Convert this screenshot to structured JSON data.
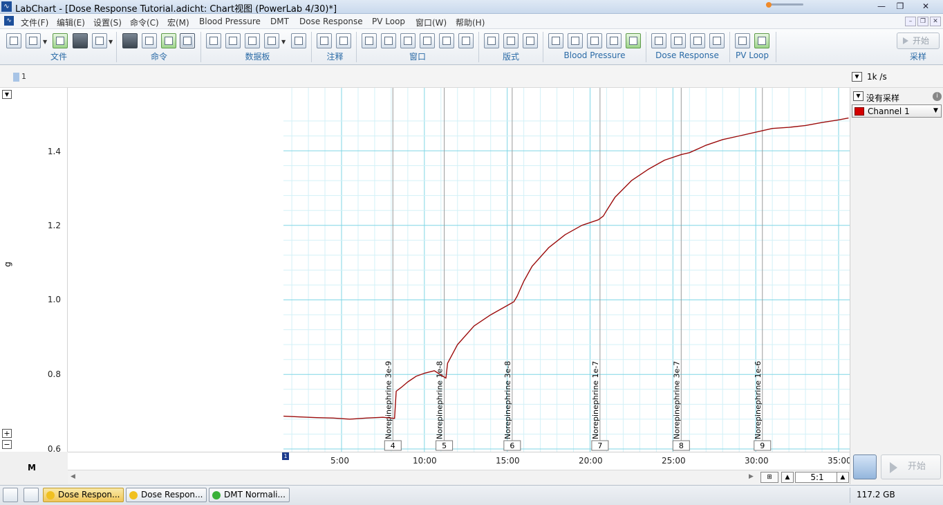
{
  "window": {
    "title": "LabChart - [Dose Response Tutorial.adicht: Chart视图 (PowerLab 4/30)*]",
    "app_icon": "labchart-icon",
    "controls": [
      "—",
      "❐",
      "✕"
    ]
  },
  "menu": {
    "items": [
      "文件(F)",
      "编辑(E)",
      "设置(S)",
      "命令(C)",
      "宏(M)",
      "Blood Pressure",
      "DMT",
      "Dose Response",
      "PV Loop",
      "窗口(W)",
      "帮助(H)"
    ],
    "mdi_controls": [
      "–",
      "❐",
      "✕"
    ]
  },
  "toolbar": {
    "groups": [
      "文件",
      "命令",
      "数据板",
      "注释",
      "窗口",
      "版式",
      "Blood Pressure",
      "Dose Response",
      "PV Loop",
      "采样"
    ],
    "start_label": "开始"
  },
  "channel_strip": {
    "channel_number": "1",
    "rate": "1k /s"
  },
  "left_axis": {
    "unit": "g",
    "ticks": [
      "1.4",
      "1.2",
      "1.0",
      "0.8",
      "0.6"
    ],
    "bottom_marker": "M"
  },
  "x_axis": {
    "ticks": [
      "5:00",
      "10:00",
      "15:00",
      "20:00",
      "25:00",
      "30:00",
      "35:00"
    ],
    "block_marker": "1"
  },
  "right_panel": {
    "sampling_status": "没有采样",
    "channel_select": "Channel 1",
    "channel_color": "#d40000"
  },
  "scroll": {
    "ratio": "5:1"
  },
  "bottom_start_label": "开始",
  "statusbar": {
    "tabs": [
      "Dose Respon...",
      "Dose Respon...",
      "DMT Normali..."
    ],
    "tab_dot_colors": [
      "#f0c020",
      "#f0c020",
      "#38b038"
    ],
    "disk": "117.2 GB"
  },
  "chart_data": {
    "type": "line",
    "xlabel": "",
    "ylabel": "g",
    "xlim_minutes": [
      1.5,
      35.6
    ],
    "ylim": [
      0.6,
      1.5
    ],
    "series": [
      {
        "color": "#9b0b0b",
        "points": [
          [
            1.5,
            0.688
          ],
          [
            2.5,
            0.686
          ],
          [
            3.5,
            0.684
          ],
          [
            4.5,
            0.683
          ],
          [
            5.5,
            0.68
          ],
          [
            6.5,
            0.683
          ],
          [
            7.5,
            0.685
          ],
          [
            8.2,
            0.682
          ],
          [
            8.3,
            0.755
          ],
          [
            8.6,
            0.765
          ],
          [
            9.0,
            0.78
          ],
          [
            9.5,
            0.795
          ],
          [
            10.0,
            0.803
          ],
          [
            10.6,
            0.81
          ],
          [
            11.3,
            0.79
          ],
          [
            11.4,
            0.83
          ],
          [
            12.0,
            0.88
          ],
          [
            13.0,
            0.93
          ],
          [
            14.0,
            0.96
          ],
          [
            15.0,
            0.985
          ],
          [
            15.4,
            0.995
          ],
          [
            15.6,
            1.01
          ],
          [
            16.0,
            1.05
          ],
          [
            16.5,
            1.09
          ],
          [
            17.5,
            1.14
          ],
          [
            18.5,
            1.175
          ],
          [
            19.5,
            1.2
          ],
          [
            20.5,
            1.215
          ],
          [
            20.8,
            1.225
          ],
          [
            21.0,
            1.24
          ],
          [
            21.5,
            1.275
          ],
          [
            22.5,
            1.32
          ],
          [
            23.5,
            1.35
          ],
          [
            24.5,
            1.375
          ],
          [
            25.5,
            1.39
          ],
          [
            26.0,
            1.395
          ],
          [
            27.0,
            1.415
          ],
          [
            28.0,
            1.43
          ],
          [
            29.0,
            1.44
          ],
          [
            30.0,
            1.45
          ],
          [
            31.0,
            1.46
          ],
          [
            32.0,
            1.463
          ],
          [
            33.0,
            1.468
          ],
          [
            34.0,
            1.476
          ],
          [
            35.0,
            1.483
          ],
          [
            35.6,
            1.488
          ]
        ]
      }
    ],
    "comments": [
      {
        "x": 8.1,
        "text": "Norepinephrine 3e-9",
        "id": "4"
      },
      {
        "x": 11.2,
        "text": "Norepinephrine 1e-8",
        "id": "5"
      },
      {
        "x": 15.3,
        "text": "Norepinephrine 3e-8",
        "id": "6"
      },
      {
        "x": 20.6,
        "text": "Norepinephrine 1e-7",
        "id": "7"
      },
      {
        "x": 25.5,
        "text": "Norepinephrine 3e-7",
        "id": "8"
      },
      {
        "x": 30.4,
        "text": "Norepinephrine 1e-6",
        "id": "9"
      }
    ],
    "grid": true
  }
}
